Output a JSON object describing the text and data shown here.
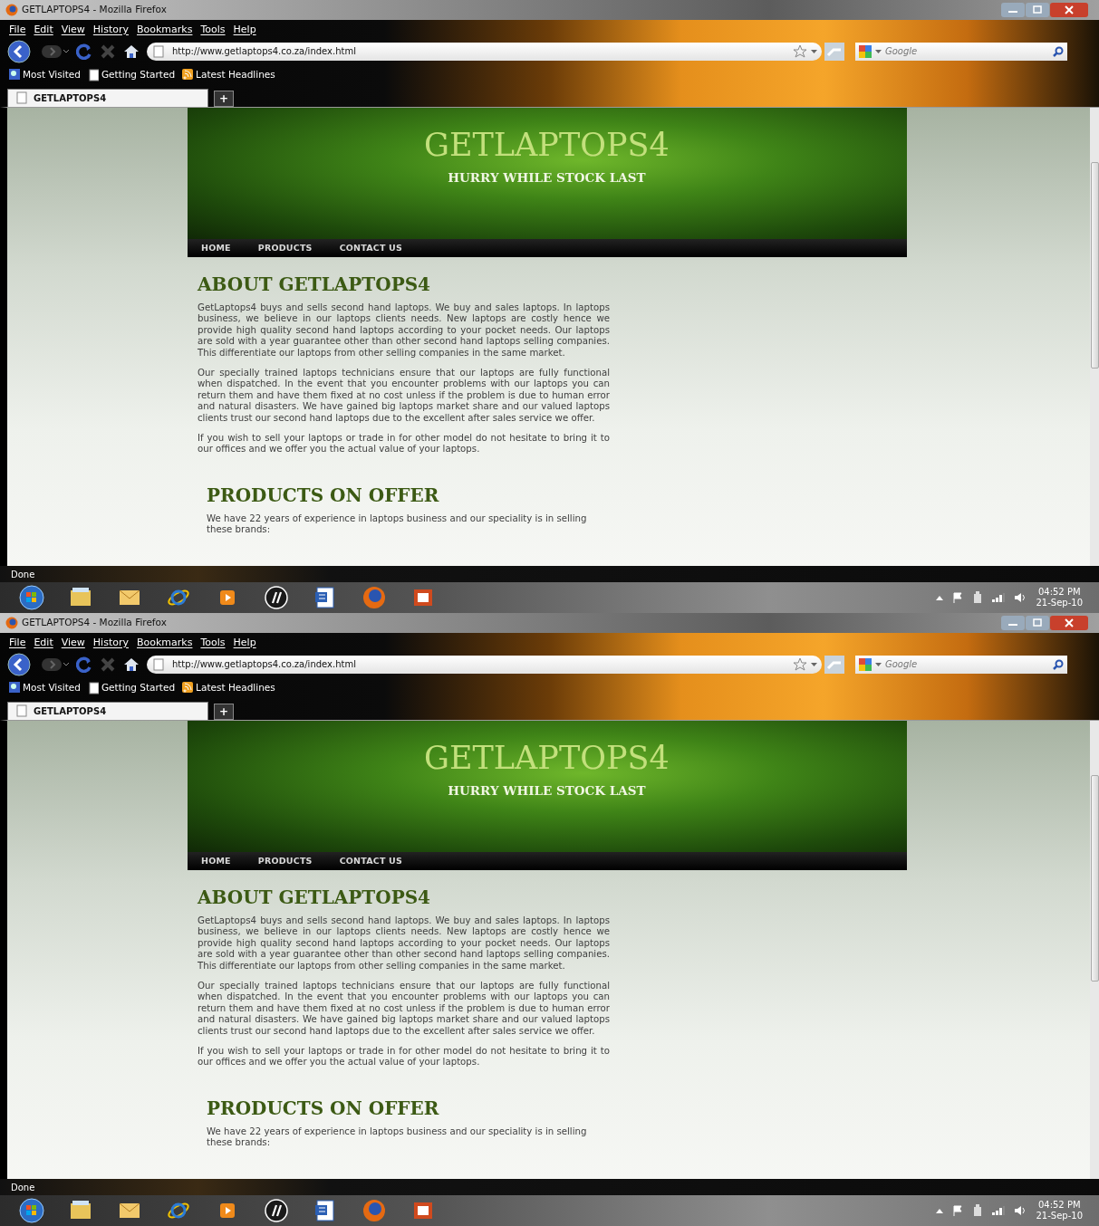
{
  "screens": [
    {
      "window": {
        "title": "GETLAPTOPS4 - Mozilla Firefox"
      },
      "menu": [
        "File",
        "Edit",
        "View",
        "History",
        "Bookmarks",
        "Tools",
        "Help"
      ],
      "address": "http://www.getlaptops4.co.za/index.html",
      "search": {
        "placeholder": "Google"
      },
      "bookmarks": [
        "Most Visited",
        "Getting Started",
        "Latest Headlines"
      ],
      "tabs": [
        {
          "label": "GETLAPTOPS4",
          "selected": true
        }
      ],
      "new_tab": "+",
      "page": {
        "site_title": "GETLAPTOPS4",
        "tagline": "HURRY WHILE STOCK LAST",
        "nav": [
          "HOME",
          "PRODUCTS",
          "CONTACT US"
        ],
        "sections": [
          {
            "heading": "ABOUT GETLAPTOPS4",
            "paragraphs": [
              "GetLaptops4 buys and sells second hand laptops. We buy and sales laptops. In laptops business, we believe in our laptops clients needs. New laptops are costly hence we provide high quality second hand laptops according to your pocket needs. Our laptops are sold with a year guarantee other than other second hand laptops selling companies. This differentiate our laptops from other selling companies in the same market.",
              "Our specially trained laptops technicians ensure that our laptops are fully functional when dispatched. In the event that you encounter problems with our laptops you can return them and have them fixed at no cost unless if the problem is due to human error and natural disasters. We have gained big laptops market share and our valued laptops clients trust our second hand laptops due to the excellent after sales service we offer.",
              "If you wish to sell your laptops or trade in for other model do not hesitate to bring it to our offices and we offer you the actual value of your laptops."
            ]
          },
          {
            "heading": "PRODUCTS ON OFFER",
            "paragraphs": [
              "We have 22 years of experience in laptops business and our speciality is in selling these brands:"
            ]
          }
        ]
      },
      "status_bar": "Done",
      "clock": {
        "time": "04:52 PM",
        "date": "21-Sep-10"
      }
    },
    {
      "window": {
        "title": "GETLAPTOPS4 - Mozilla Firefox"
      },
      "menu": [
        "File",
        "Edit",
        "View",
        "History",
        "Bookmarks",
        "Tools",
        "Help"
      ],
      "address": "http://www.getlaptops4.co.za/index.html",
      "search": {
        "placeholder": "Google"
      },
      "bookmarks": [
        "Most Visited",
        "Getting Started",
        "Latest Headlines"
      ],
      "tabs": [
        {
          "label": "GETLAPTOPS4",
          "selected": true
        }
      ],
      "new_tab": "+",
      "page": {
        "site_title": "GETLAPTOPS4",
        "tagline": "HURRY WHILE STOCK LAST",
        "nav": [
          "HOME",
          "PRODUCTS",
          "CONTACT US"
        ],
        "sections": [
          {
            "heading": "ABOUT GETLAPTOPS4",
            "paragraphs": [
              "GetLaptops4 buys and sells second hand laptops. We buy and sales laptops. In laptops business, we believe in our laptops clients needs. New laptops are costly hence we provide high quality second hand laptops according to your pocket needs. Our laptops are sold with a year guarantee other than other second hand laptops selling companies. This differentiate our laptops from other selling companies in the same market.",
              "Our specially trained laptops technicians ensure that our laptops are fully functional when dispatched. In the event that you encounter problems with our laptops you can return them and have them fixed at no cost unless if the problem is due to human error and natural disasters. We have gained big laptops market share and our valued laptops clients trust our second hand laptops due to the excellent after sales service we offer.",
              "If you wish to sell your laptops or trade in for other model do not hesitate to bring it to our offices and we offer you the actual value of your laptops."
            ]
          },
          {
            "heading": "PRODUCTS ON OFFER",
            "paragraphs": [
              "We have 22 years of experience in laptops business and our speciality is in selling these brands:"
            ]
          }
        ]
      },
      "status_bar": "Done",
      "clock": {
        "time": "04:52 PM",
        "date": "21-Sep-10"
      }
    }
  ]
}
